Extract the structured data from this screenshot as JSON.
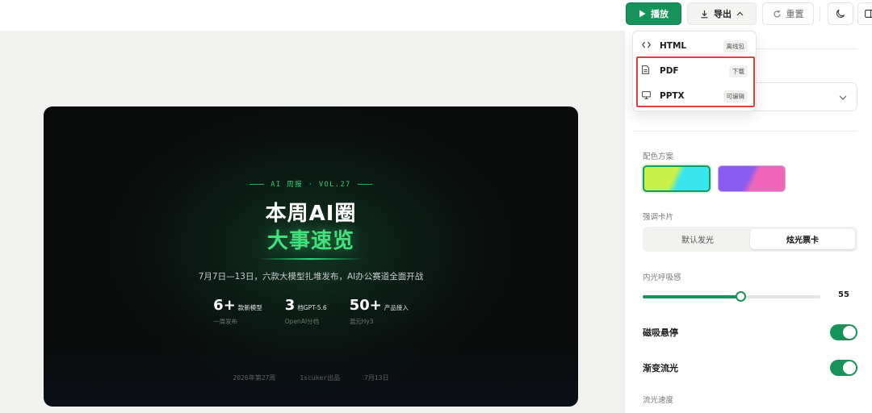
{
  "toolbar": {
    "play_label": "播放",
    "export_label": "导出",
    "reset_label": "重置"
  },
  "export_menu": {
    "items": [
      {
        "label": "HTML",
        "badge": "离线包",
        "icon": "code-icon"
      },
      {
        "label": "PDF",
        "badge": "下载",
        "icon": "document-icon"
      },
      {
        "label": "PPTX",
        "badge": "可编辑",
        "icon": "monitor-icon"
      }
    ]
  },
  "slide": {
    "kicker": "AI 周报 · VOL.27",
    "title_line1": "本周AI圈",
    "title_line2": "大事速览",
    "subtitle": "7月7日—13日，六款大模型扎堆发布，AI办公赛道全面开战",
    "stats": [
      {
        "num": "6+",
        "unit": "款新模型",
        "desc": "一周发布"
      },
      {
        "num": "3",
        "unit": "档GPT-5.6",
        "desc": "OpenAI分档"
      },
      {
        "num": "50+",
        "unit": "产品接入",
        "desc": "混元Hy3"
      }
    ],
    "footer": [
      "2026年第27周",
      "1scuker出品",
      "7月13日"
    ]
  },
  "settings": {
    "color_scheme_label": "配色方案",
    "accent_card_label": "强调卡片",
    "accent_options": [
      "默认发光",
      "炫光票卡"
    ],
    "accent_selected": "炫光票卡",
    "glow_label": "内光呼吸感",
    "glow_value": "55",
    "glow_fraction": 0.55,
    "toggle1_label": "磁吸悬停",
    "toggle1_on": true,
    "toggle2_label": "渐变流光",
    "toggle2_on": true,
    "flow_speed_label": "流光速度"
  },
  "colors": {
    "accent": "#16935b",
    "highlight": "#e0413e",
    "slide_green": "#43e07c"
  }
}
